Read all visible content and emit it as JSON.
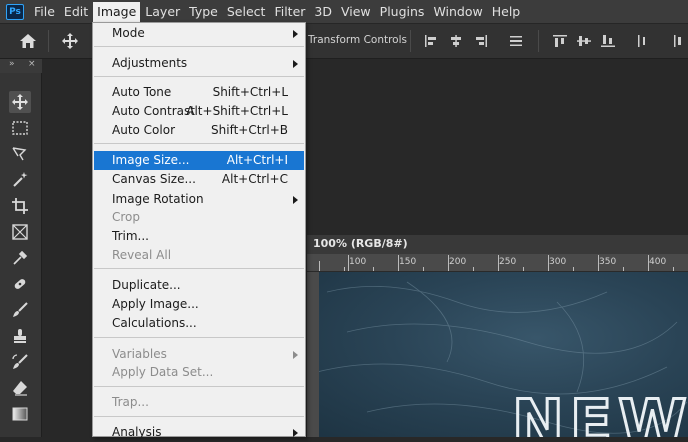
{
  "menubar": {
    "logo": "Ps",
    "items": [
      "File",
      "Edit",
      "Image",
      "Layer",
      "Type",
      "Select",
      "Filter",
      "3D",
      "View",
      "Plugins",
      "Window",
      "Help"
    ]
  },
  "options_bar": {
    "transform_controls": "Transform Controls"
  },
  "panel_header": {
    "collapse": "»",
    "close": "×"
  },
  "document": {
    "tab_title": "100% (RGB/8#)",
    "ruler_labels": [
      "100",
      "150",
      "200",
      "250",
      "300",
      "350",
      "400"
    ],
    "canvas_text": "NEW"
  },
  "image_menu": {
    "items": [
      {
        "label": "Mode",
        "shortcut": "",
        "submenu": true,
        "disabled": false
      },
      {
        "label": "Adjustments",
        "shortcut": "",
        "submenu": true,
        "disabled": false
      },
      {
        "label": "Auto Tone",
        "shortcut": "Shift+Ctrl+L",
        "submenu": false,
        "disabled": false
      },
      {
        "label": "Auto Contrast",
        "shortcut": "Alt+Shift+Ctrl+L",
        "submenu": false,
        "disabled": false
      },
      {
        "label": "Auto Color",
        "shortcut": "Shift+Ctrl+B",
        "submenu": false,
        "disabled": false
      },
      {
        "label": "Image Size...",
        "shortcut": "Alt+Ctrl+I",
        "submenu": false,
        "disabled": false
      },
      {
        "label": "Canvas Size...",
        "shortcut": "Alt+Ctrl+C",
        "submenu": false,
        "disabled": false
      },
      {
        "label": "Image Rotation",
        "shortcut": "",
        "submenu": true,
        "disabled": false
      },
      {
        "label": "Crop",
        "shortcut": "",
        "submenu": false,
        "disabled": true
      },
      {
        "label": "Trim...",
        "shortcut": "",
        "submenu": false,
        "disabled": false
      },
      {
        "label": "Reveal All",
        "shortcut": "",
        "submenu": false,
        "disabled": true
      },
      {
        "label": "Duplicate...",
        "shortcut": "",
        "submenu": false,
        "disabled": false
      },
      {
        "label": "Apply Image...",
        "shortcut": "",
        "submenu": false,
        "disabled": false
      },
      {
        "label": "Calculations...",
        "shortcut": "",
        "submenu": false,
        "disabled": false
      },
      {
        "label": "Variables",
        "shortcut": "",
        "submenu": true,
        "disabled": true
      },
      {
        "label": "Apply Data Set...",
        "shortcut": "",
        "submenu": false,
        "disabled": true
      },
      {
        "label": "Trap...",
        "shortcut": "",
        "submenu": false,
        "disabled": true
      },
      {
        "label": "Analysis",
        "shortcut": "",
        "submenu": true,
        "disabled": false
      }
    ],
    "highlighted": "Image Size..."
  },
  "tools": [
    "move-tool",
    "marquee-tool",
    "lasso-tool",
    "magic-wand-tool",
    "crop-tool",
    "frame-tool",
    "eyedropper-tool",
    "healing-brush-tool",
    "brush-tool",
    "clone-stamp-tool",
    "history-brush-tool",
    "eraser-tool",
    "gradient-tool"
  ],
  "colors": {
    "menu_highlight": "#1976d2",
    "app_bg": "#282828",
    "menubar_bg": "#3c3c3c"
  }
}
